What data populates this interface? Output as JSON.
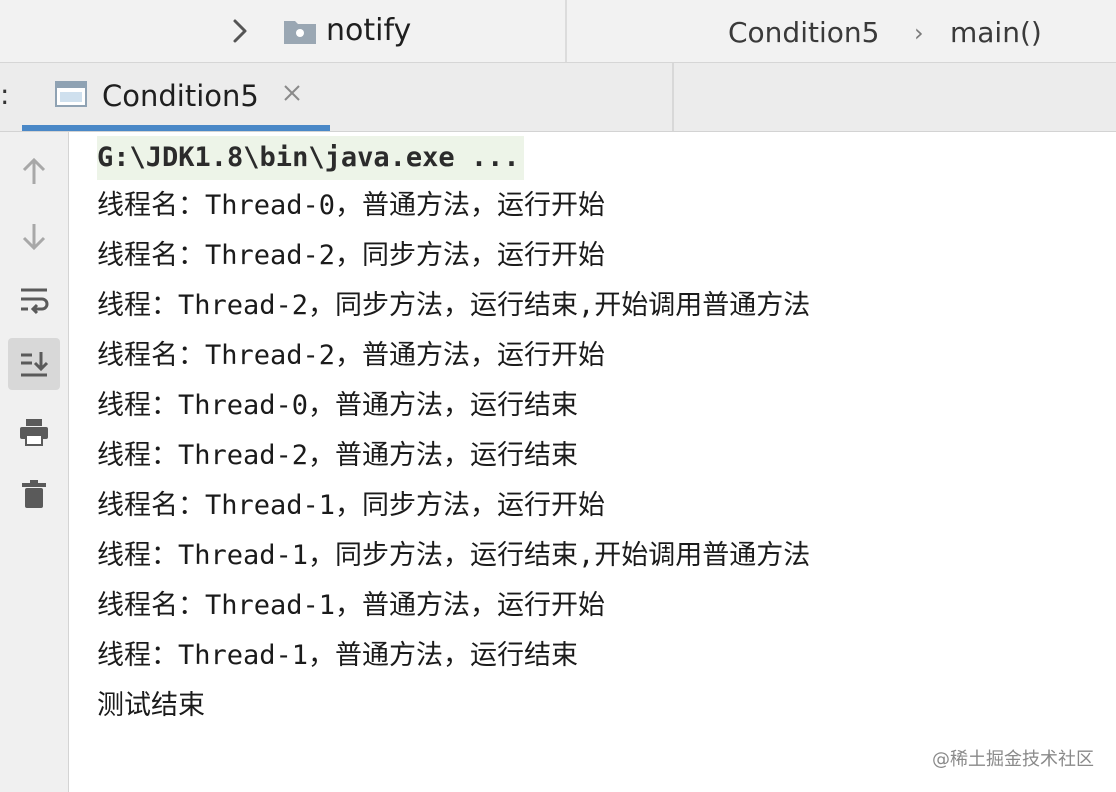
{
  "breadcrumb": {
    "project": "notify",
    "class": "Condition5",
    "separator": "›",
    "method": "main()"
  },
  "tabs": {
    "leading": ":",
    "active_label": "Condition5",
    "close_glyph": "×"
  },
  "toolbar": {
    "icons": [
      "arrow-up-icon",
      "arrow-down-icon",
      "soft-wrap-icon",
      "scroll-to-end-icon",
      "print-icon",
      "trash-icon"
    ]
  },
  "console": {
    "command": "G:\\JDK1.8\\bin\\java.exe ...",
    "lines": [
      "线程名：Thread-0，普通方法，运行开始",
      "线程名：Thread-2，同步方法，运行开始",
      "线程：Thread-2，同步方法，运行结束,开始调用普通方法",
      "线程名：Thread-2，普通方法，运行开始",
      "线程：Thread-0，普通方法，运行结束",
      "线程：Thread-2，普通方法，运行结束",
      "线程名：Thread-1，同步方法，运行开始",
      "线程：Thread-1，同步方法，运行结束,开始调用普通方法",
      "线程名：Thread-1，普通方法，运行开始",
      "线程：Thread-1，普通方法，运行结束",
      "测试结束"
    ]
  },
  "watermark": "@稀土掘金技术社区",
  "colors": {
    "accent": "#4a88c7",
    "command_bg": "#edf4e8"
  }
}
